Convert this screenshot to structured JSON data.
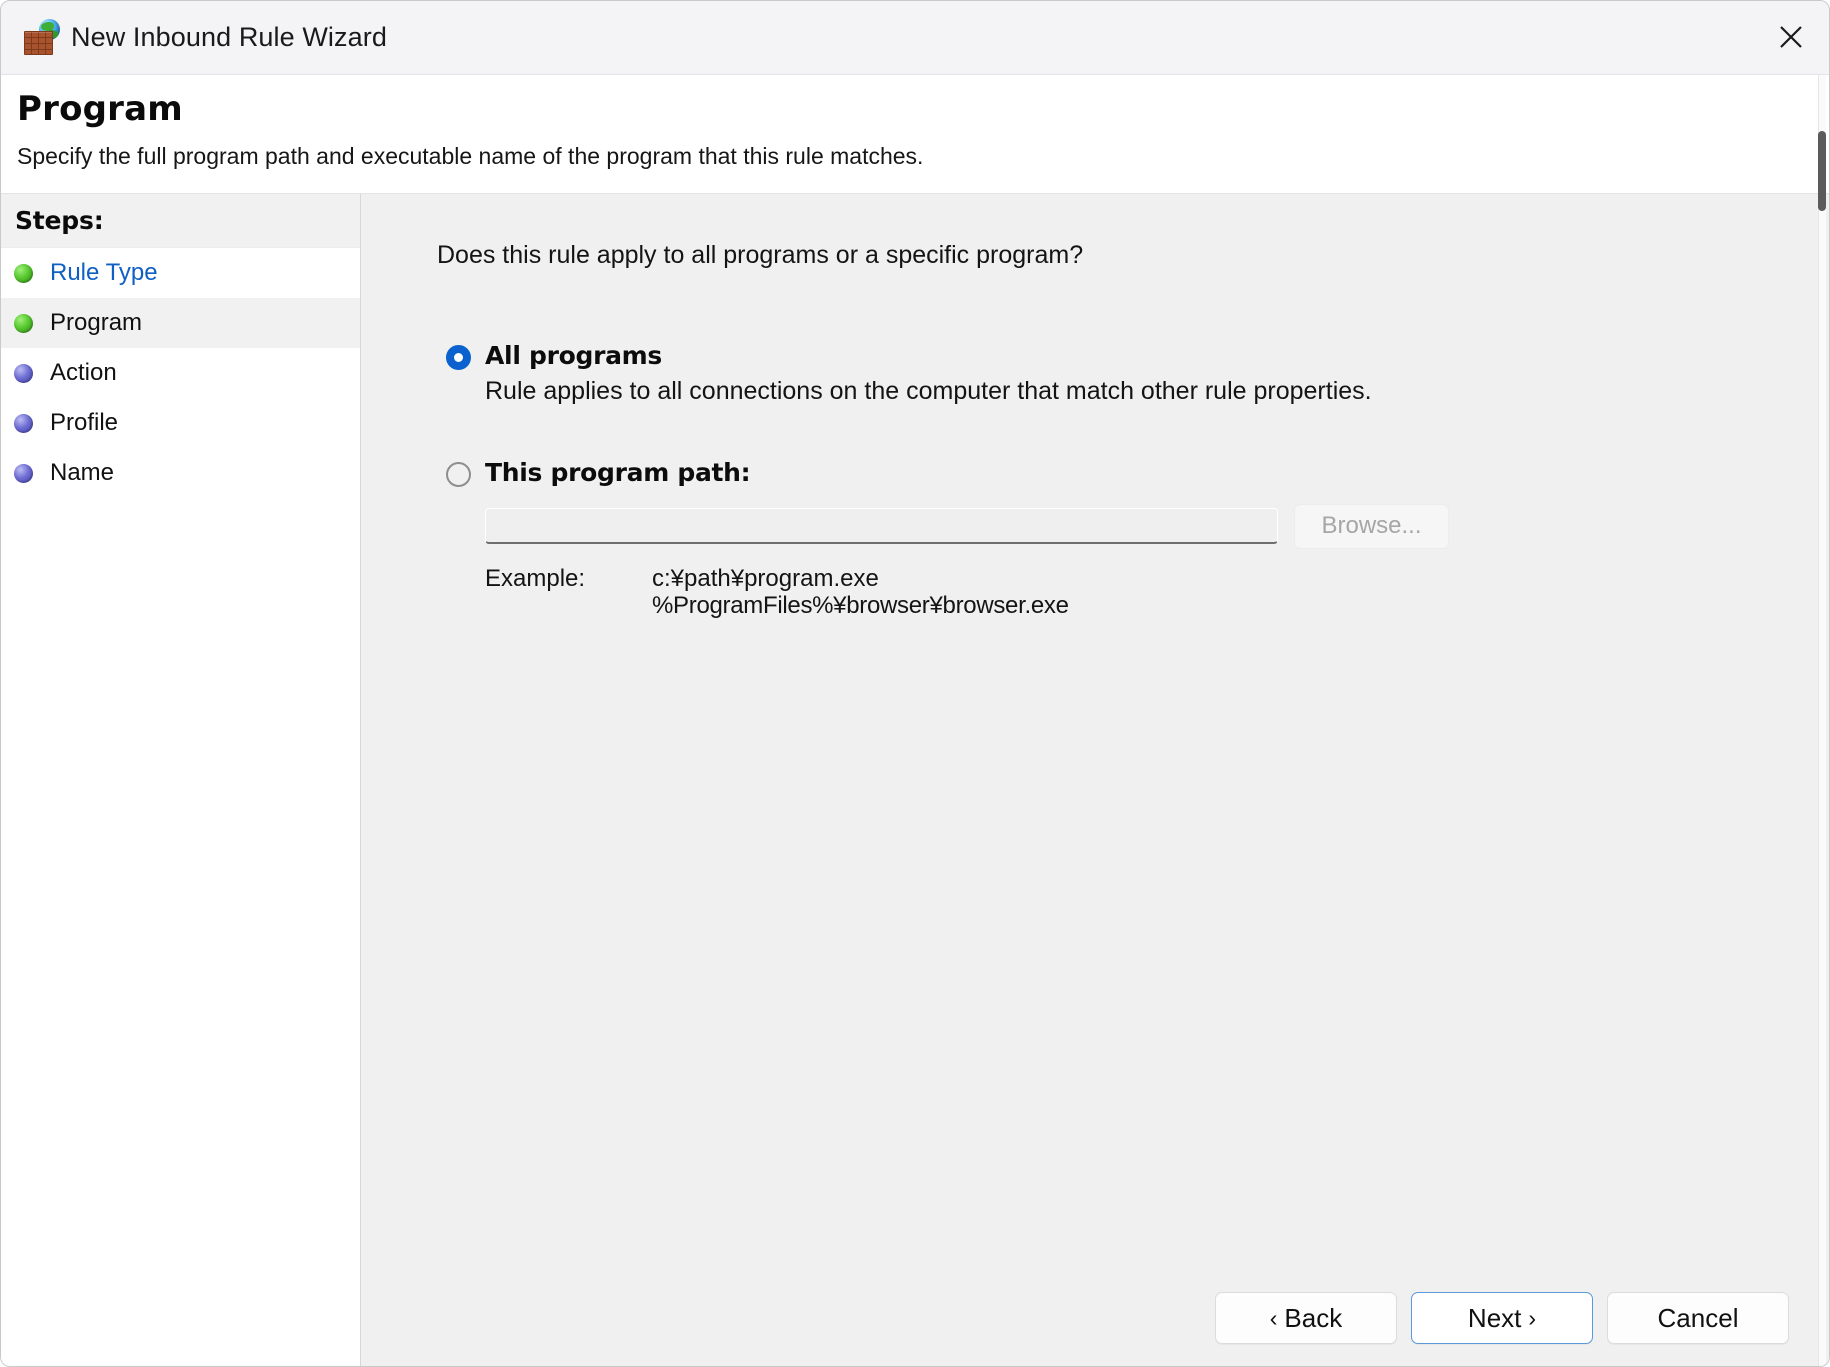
{
  "titlebar": {
    "title": "New Inbound Rule Wizard",
    "icon": "firewall-brick-globe-icon",
    "close_label": "✕"
  },
  "header": {
    "title": "Program",
    "subtitle": "Specify the full program path and executable name of the program that this rule matches."
  },
  "sidebar": {
    "heading": "Steps:",
    "items": [
      {
        "label": "Rule Type",
        "state": "done",
        "current": false
      },
      {
        "label": "Program",
        "state": "done",
        "current": true
      },
      {
        "label": "Action",
        "state": "todo",
        "current": false
      },
      {
        "label": "Profile",
        "state": "todo",
        "current": false
      },
      {
        "label": "Name",
        "state": "todo",
        "current": false
      }
    ]
  },
  "main": {
    "question": "Does this rule apply to all programs or a specific program?",
    "options": [
      {
        "id": "all-programs",
        "title": "All programs",
        "description": "Rule applies to all connections on the computer that match other rule properties.",
        "selected": true
      },
      {
        "id": "this-program-path",
        "title": "This program path:",
        "selected": false
      }
    ],
    "path_field": {
      "value": "",
      "placeholder": "",
      "disabled": true
    },
    "browse_button": {
      "label": "Browse...",
      "disabled": true
    },
    "example": {
      "label": "Example:",
      "lines": [
        "c:¥path¥program.exe",
        "%ProgramFiles%¥browser¥browser.exe"
      ]
    }
  },
  "footer": {
    "back": "Back",
    "back_chevron": "‹",
    "next": "Next",
    "next_chevron": "›",
    "cancel": "Cancel"
  },
  "colors": {
    "accent": "#0b62ce",
    "link": "#1060c4",
    "panel": "#f0f0f0",
    "titlebar": "#f4f3f6",
    "step_done": "#58c92f",
    "step_todo": "#6f6fd4",
    "focus_border": "#5a9ad8"
  }
}
